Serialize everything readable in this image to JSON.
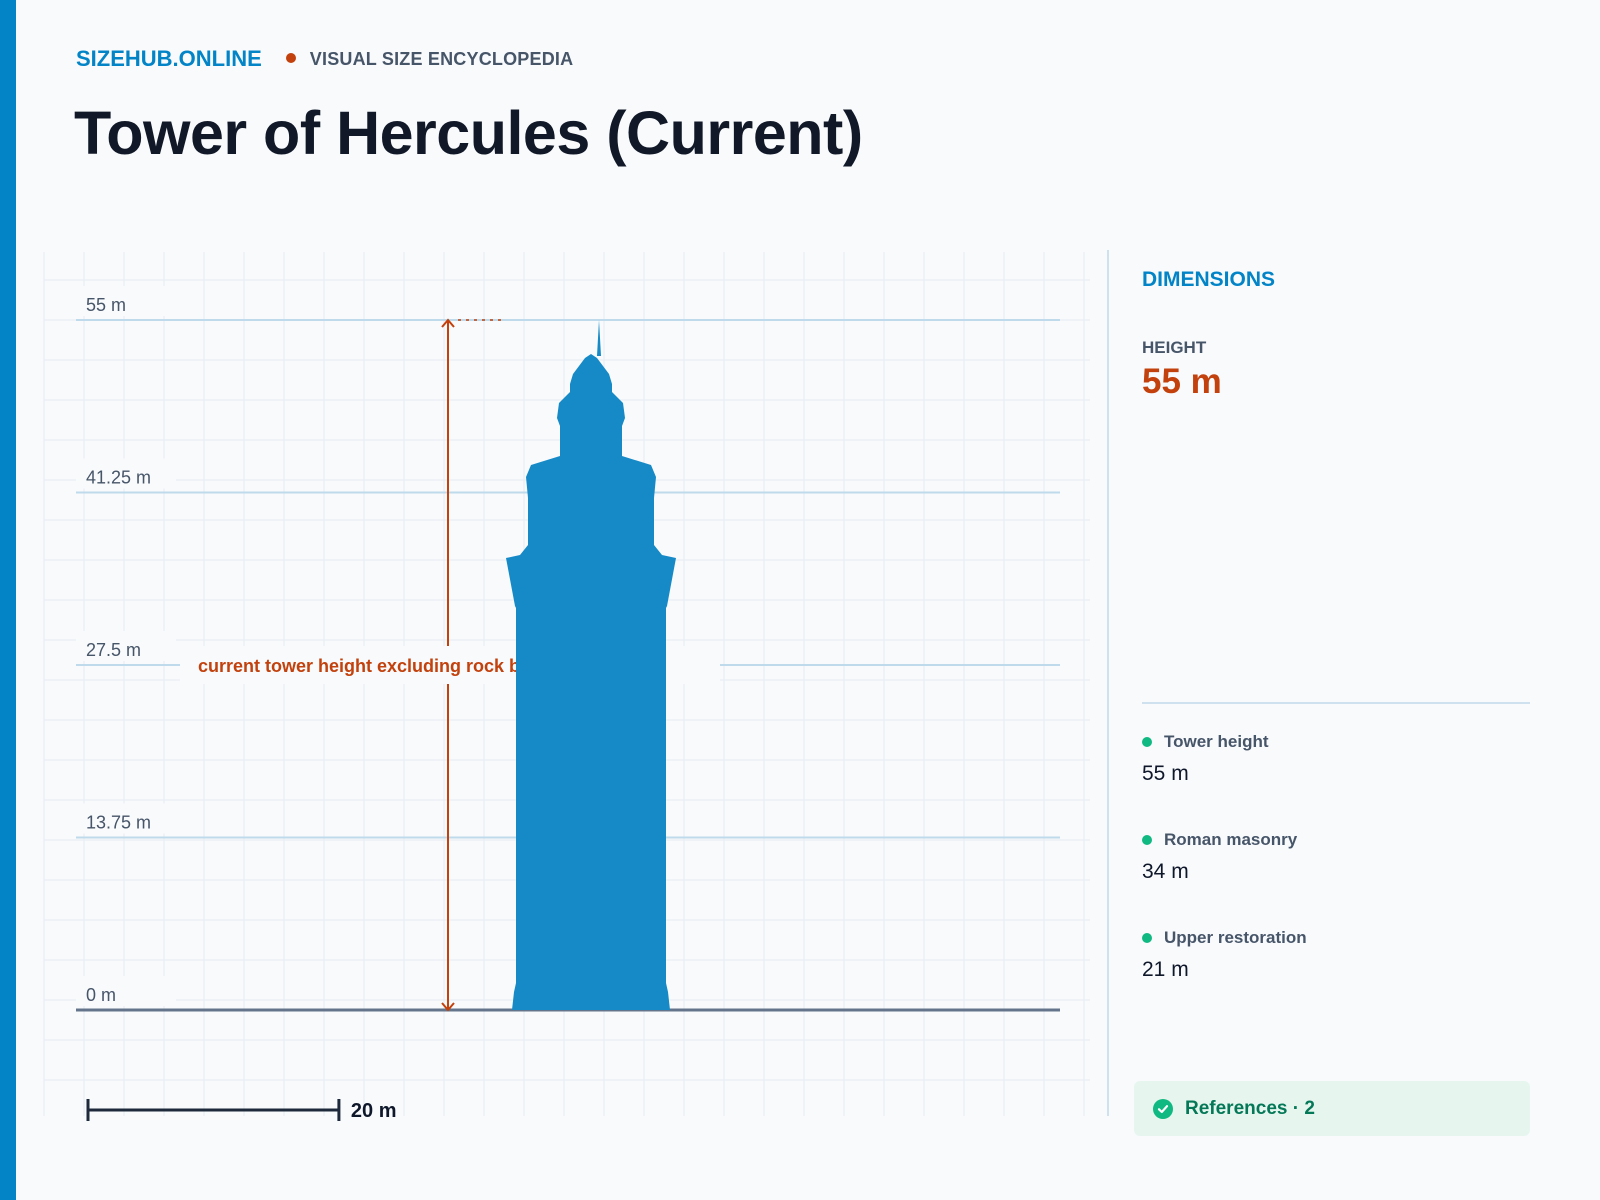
{
  "header": {
    "brand": "SIZEHUB.ONLINE",
    "tagline": "VISUAL SIZE ENCYCLOPEDIA",
    "title": "Tower of Hercules (Current)"
  },
  "chart_data": {
    "type": "height-comparison",
    "y_unit": "m",
    "ylim": [
      0,
      55
    ],
    "tick_labels": [
      "0 m",
      "13.75 m",
      "27.5 m",
      "41.25 m",
      "55 m"
    ],
    "tick_values": [
      0,
      13.75,
      27.5,
      41.25,
      55
    ],
    "annotation": {
      "label": "current tower height excluding rock base · 55 m",
      "value": 55
    },
    "scale_bar": {
      "label": "20 m",
      "value": 20
    },
    "colors": {
      "silhouette": "#1689c7",
      "annotation": "#c2410c",
      "gridline": "#bfdbeb",
      "ground": "#64748b"
    }
  },
  "dimensions": {
    "title": "DIMENSIONS",
    "height_label": "HEIGHT",
    "height_value": "55 m",
    "items": [
      {
        "label": "Tower height",
        "value": "55 m"
      },
      {
        "label": "Roman masonry",
        "value": "34 m"
      },
      {
        "label": "Upper restoration",
        "value": "21 m"
      }
    ]
  },
  "references": {
    "label": "References · 2",
    "icon": "check-circle-icon"
  }
}
